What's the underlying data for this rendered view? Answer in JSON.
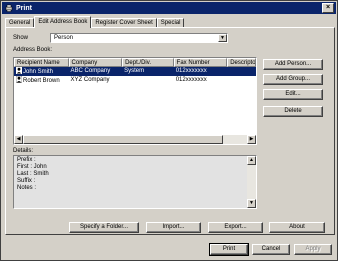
{
  "window": {
    "title": "Print",
    "close_label": "×"
  },
  "tabs": [
    {
      "label": "General"
    },
    {
      "label": "Edit Address Book"
    },
    {
      "label": "Register Cover Sheet"
    },
    {
      "label": "Special"
    }
  ],
  "show": {
    "label": "Show",
    "value": "Person"
  },
  "address_book": {
    "label": "Address Book:",
    "columns": [
      "Recipient Name",
      "Company",
      "Dept./Div.",
      "Fax Number",
      "Descriptor"
    ],
    "rows": [
      {
        "name": "John Smith",
        "company": "ABC Company",
        "dept": "System",
        "fax": "012xxxxxxx",
        "selected": true
      },
      {
        "name": "Robert Brown",
        "company": "XYZ Company",
        "dept": "",
        "fax": "012xxxxxxx",
        "selected": false
      }
    ]
  },
  "side_buttons": {
    "add_person": "Add Person...",
    "add_group": "Add Group...",
    "edit": "Edit...",
    "delete": "Delete"
  },
  "details": {
    "label": "Details:",
    "lines": [
      "Prefix :",
      "First    : John",
      "Last    : Smith",
      "Suffix :",
      "Notes :"
    ]
  },
  "bottom_buttons": {
    "specify_folder": "Specify a Folder...",
    "import": "Import...",
    "export": "Export...",
    "about": "About"
  },
  "dialog_buttons": {
    "print": "Print",
    "cancel": "Cancel",
    "apply": "Apply"
  },
  "icons": {
    "window": "printer-icon",
    "recipient": "person-icon",
    "dropdown": "chevron-down-icon"
  },
  "colors": {
    "selection": "#0a246a",
    "titlebar": "#0a246a",
    "face": "#d4d0c8"
  }
}
